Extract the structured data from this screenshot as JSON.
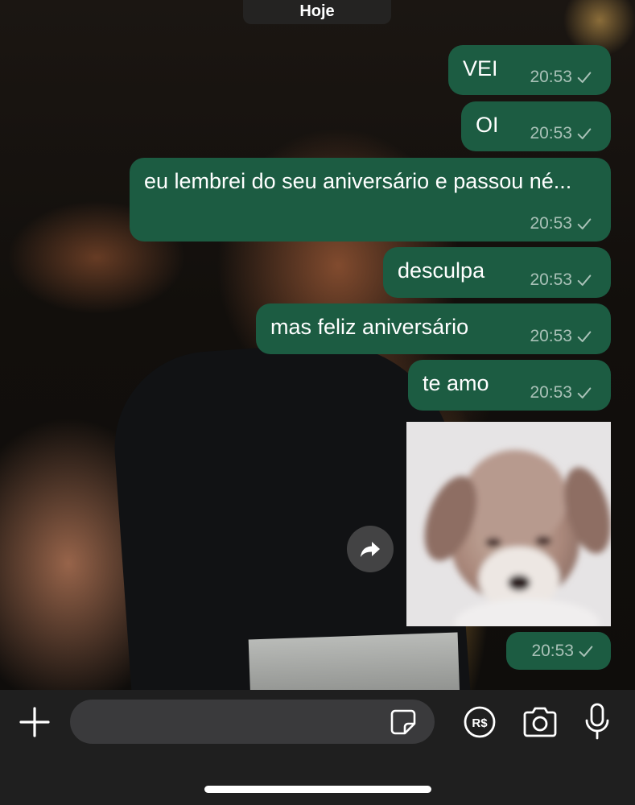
{
  "chat": {
    "date_label": "Hoje",
    "messages": [
      {
        "text": "VEI",
        "time": "20:53",
        "status": "sent"
      },
      {
        "text": "OI",
        "time": "20:53",
        "status": "sent"
      },
      {
        "text": "eu lembrei do seu aniversário e passou né...",
        "time": "20:53",
        "status": "sent"
      },
      {
        "text": "desculpa",
        "time": "20:53",
        "status": "sent"
      },
      {
        "text": "mas feliz aniversário",
        "time": "20:53",
        "status": "sent"
      },
      {
        "text": "te amo",
        "time": "20:53",
        "status": "sent"
      }
    ],
    "sticker": {
      "description": "sad puppy sticker",
      "time": "20:53",
      "status": "sent"
    }
  },
  "icons": {
    "forward": "forward-arrow-icon",
    "check": "single-check-icon",
    "attach": "plus-icon",
    "sticker": "sticker-icon",
    "payment": "pix-real-icon",
    "camera": "camera-icon",
    "mic": "microphone-icon"
  },
  "composer": {
    "value": "",
    "placeholder": ""
  },
  "colors": {
    "outgoing_bubble": "#1c5c42",
    "composer_bg": "#1f1f1f",
    "input_bg": "#3a3a3c"
  }
}
